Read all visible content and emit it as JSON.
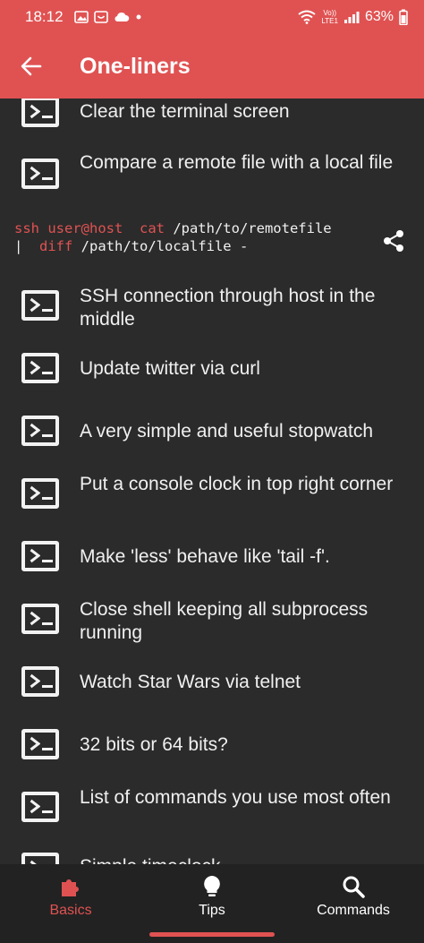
{
  "status_bar": {
    "time": "18:12",
    "network_label_top": "Vo))",
    "network_label_bottom": "LTE1",
    "battery": "63%"
  },
  "app_bar": {
    "title": "One-liners"
  },
  "items": [
    {
      "label": "Clear the terminal screen"
    },
    {
      "label": "Compare a remote file with a local file"
    },
    {
      "label": "SSH connection through host in the middle"
    },
    {
      "label": "Update twitter via curl"
    },
    {
      "label": "A very simple and useful stopwatch"
    },
    {
      "label": "Put a console clock in top right corner"
    },
    {
      "label": "Make 'less' behave like 'tail -f'."
    },
    {
      "label": "Close shell keeping all subprocess running"
    },
    {
      "label": "Watch Star Wars via telnet"
    },
    {
      "label": "32 bits or 64 bits?"
    },
    {
      "label": "List of commands you use most often"
    },
    {
      "label": "Simple timeclock"
    }
  ],
  "code": {
    "line1_plain": "ssh user@host  ",
    "line1_kw": "cat",
    "line1_rest": " /path/to/remotefile",
    "line2_pipe": "|  ",
    "line2_kw": "diff",
    "line2_rest": " /path/to/localfile -"
  },
  "bottom_nav": {
    "basics": "Basics",
    "tips": "Tips",
    "commands": "Commands"
  },
  "icons": {
    "back": "arrow-back-icon",
    "terminal": "terminal-icon",
    "share": "share-icon",
    "basics": "puzzle-piece-icon",
    "tips": "lightbulb-icon",
    "commands": "search-icon"
  },
  "colors": {
    "accent": "#e05252",
    "background": "#2b2b2b",
    "nav_background": "#222222"
  }
}
